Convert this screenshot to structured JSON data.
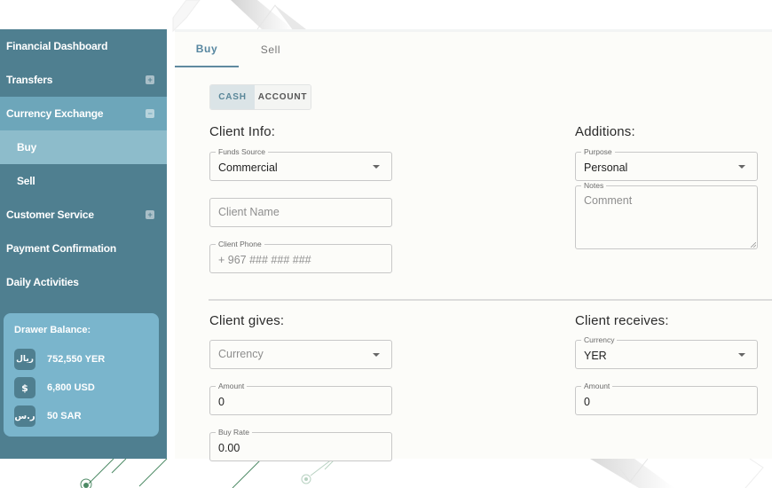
{
  "sidebar": {
    "items": [
      {
        "label": "Financial Dashboard",
        "toggle": ""
      },
      {
        "label": "Transfers",
        "toggle": "+"
      },
      {
        "label": "Currency Exchange",
        "toggle": "−"
      },
      {
        "label": "Buy",
        "toggle": ""
      },
      {
        "label": "Sell",
        "toggle": ""
      },
      {
        "label": "Customer Service",
        "toggle": "+"
      },
      {
        "label": "Payment Confirmation",
        "toggle": ""
      },
      {
        "label": "Daily Activities",
        "toggle": ""
      }
    ],
    "balance": {
      "title": "Drawer Balance:",
      "rows": [
        {
          "icon": "riyal-icon",
          "glyph": "ريال",
          "value": "752,550 YER"
        },
        {
          "icon": "dollar-icon",
          "glyph": "$",
          "value": "6,800 USD"
        },
        {
          "icon": "saudi-riyal-icon",
          "glyph": "ر.س",
          "value": "50 SAR"
        }
      ]
    }
  },
  "main": {
    "tabs": [
      {
        "label": "Buy",
        "active": true
      },
      {
        "label": "Sell",
        "active": false
      }
    ],
    "payment_mode": {
      "options": [
        "CASH",
        "ACCOUNT"
      ],
      "selected": "CASH"
    },
    "client_info": {
      "title": "Client Info:",
      "funds_source": {
        "label": "Funds Source",
        "value": "Commercial"
      },
      "client_name": {
        "placeholder": "Client Name",
        "value": ""
      },
      "client_phone": {
        "label": "Client Phone",
        "placeholder": "+ 967 ### ### ###",
        "value": ""
      }
    },
    "additions": {
      "title": "Additions:",
      "purpose": {
        "label": "Purpose",
        "value": "Personal"
      },
      "notes": {
        "label": "Notes",
        "placeholder": "Comment",
        "value": ""
      }
    },
    "client_gives": {
      "title": "Client gives:",
      "currency": {
        "placeholder": "Currency",
        "value": ""
      },
      "amount": {
        "label": "Amount",
        "value": "0"
      },
      "buy_rate": {
        "label": "Buy Rate",
        "value": "0.00"
      }
    },
    "client_receives": {
      "title": "Client receives:",
      "currency": {
        "label": "Currency",
        "value": "YER"
      },
      "amount": {
        "label": "Amount",
        "value": "0"
      }
    }
  },
  "colors": {
    "sidebar_bg": "#4f7f90",
    "sidebar_active_parent": "#6da6ba",
    "sidebar_active_child": "#8dbccb",
    "balance_card": "#7ab5cc",
    "accent": "#5686a0",
    "panel_bg": "#fcfcf9"
  }
}
